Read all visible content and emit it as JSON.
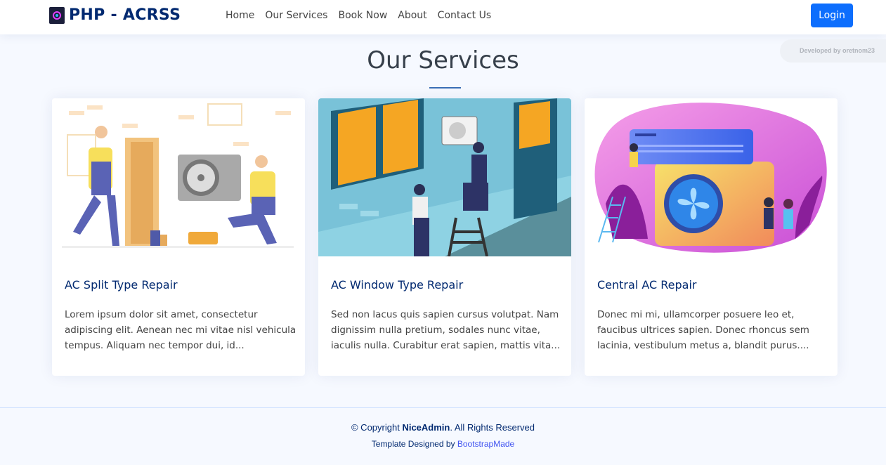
{
  "header": {
    "brand": "PHP - ACRSS",
    "nav": [
      "Home",
      "Our Services",
      "Book Now",
      "About",
      "Contact Us"
    ],
    "login_label": "Login"
  },
  "badge": "Developed by oretnom23",
  "section": {
    "title": "Our Services"
  },
  "services": [
    {
      "title": "AC Split Type Repair",
      "text": "Lorem ipsum dolor sit amet, consectetur adipiscing elit. Aenean nec mi vitae nisl vehicula tempus. Aliquam nec tempor dui, id..."
    },
    {
      "title": "AC Window Type Repair",
      "text": "Sed non lacus quis sapien cursus volutpat. Nam dignissim nulla pretium, sodales nunc vitae, iaculis nulla. Curabitur erat sapien, mattis vita..."
    },
    {
      "title": "Central AC Repair",
      "text": "Donec mi mi, ullamcorper posuere leo et, faucibus ultrices sapien. Donec rhoncus sem lacinia, vestibulum metus a, blandit purus...."
    }
  ],
  "footer": {
    "copyright_prefix": "© Copyright",
    "copyright_brand": "NiceAdmin",
    "copyright_suffix": ". All Rights Reserved",
    "credits_prefix": "Template Designed by",
    "credits_link": "BootstrapMade"
  },
  "colors": {
    "brand": "#012970",
    "primary": "#0d6efd",
    "link": "#4154f1",
    "background": "#f6f9ff"
  }
}
